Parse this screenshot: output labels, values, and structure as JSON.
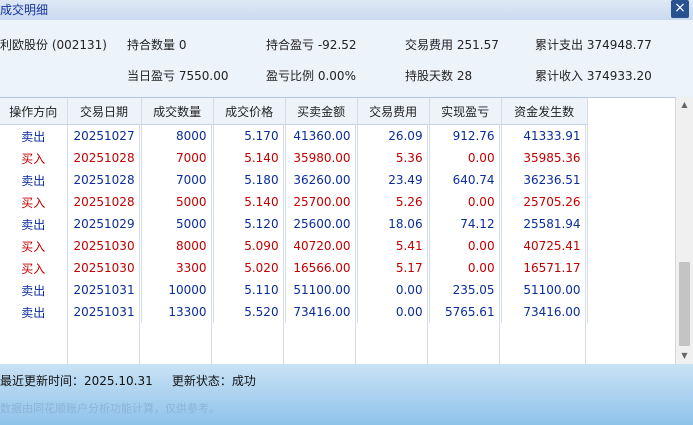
{
  "window": {
    "title": "成交明细",
    "close_icon": "×"
  },
  "summary": {
    "stock": "利欧股份 (002131)",
    "hold_qty_label": "持合数量",
    "hold_qty": "0",
    "hold_pnl_label": "持合盈亏",
    "hold_pnl": "-92.52",
    "fee_label": "交易费用",
    "fee": "251.57",
    "total_out_label": "累计支出",
    "total_out": "374948.77",
    "day_pnl_label": "当日盈亏",
    "day_pnl": "7550.00",
    "pnl_ratio_label": "盈亏比例",
    "pnl_ratio": "0.00%",
    "hold_days_label": "持股天数",
    "hold_days": "28",
    "total_in_label": "累计收入",
    "total_in": "374933.20"
  },
  "table": {
    "headers": [
      "操作方向",
      "交易日期",
      "成交数量",
      "成交价格",
      "买卖金额",
      "交易费用",
      "实现盈亏",
      "资金发生数"
    ],
    "rows": [
      {
        "type": "sell",
        "cells": [
          "卖出",
          "20251027",
          "8000",
          "5.170",
          "41360.00",
          "26.09",
          "912.76",
          "41333.91"
        ]
      },
      {
        "type": "buy",
        "cells": [
          "买入",
          "20251028",
          "7000",
          "5.140",
          "35980.00",
          "5.36",
          "0.00",
          "35985.36"
        ]
      },
      {
        "type": "sell",
        "cells": [
          "卖出",
          "20251028",
          "7000",
          "5.180",
          "36260.00",
          "23.49",
          "640.74",
          "36236.51"
        ]
      },
      {
        "type": "buy",
        "cells": [
          "买入",
          "20251028",
          "5000",
          "5.140",
          "25700.00",
          "5.26",
          "0.00",
          "25705.26"
        ]
      },
      {
        "type": "sell",
        "cells": [
          "卖出",
          "20251029",
          "5000",
          "5.120",
          "25600.00",
          "18.06",
          "74.12",
          "25581.94"
        ]
      },
      {
        "type": "buy",
        "cells": [
          "买入",
          "20251030",
          "8000",
          "5.090",
          "40720.00",
          "5.41",
          "0.00",
          "40725.41"
        ]
      },
      {
        "type": "buy",
        "cells": [
          "买入",
          "20251030",
          "3300",
          "5.020",
          "16566.00",
          "5.17",
          "0.00",
          "16571.17"
        ]
      },
      {
        "type": "sell",
        "cells": [
          "卖出",
          "20251031",
          "10000",
          "5.110",
          "51100.00",
          "0.00",
          "235.05",
          "51100.00"
        ]
      },
      {
        "type": "sell",
        "cells": [
          "卖出",
          "20251031",
          "13300",
          "5.520",
          "73416.00",
          "0.00",
          "5765.61",
          "73416.00"
        ]
      }
    ]
  },
  "footer": {
    "last_update_label": "最近更新时间：",
    "last_update": "2025.10.31",
    "update_status_label": "更新状态：",
    "update_status": "成功",
    "note": "数据由同花顺账户分析功能计算，仅供参考。"
  },
  "colors": {
    "buy": "#c00000",
    "sell": "#0b2d9a",
    "title": "#12329c"
  },
  "icons": {
    "close": "close-icon",
    "scroll_up": "chevron-up-icon",
    "scroll_down": "chevron-down-icon"
  }
}
